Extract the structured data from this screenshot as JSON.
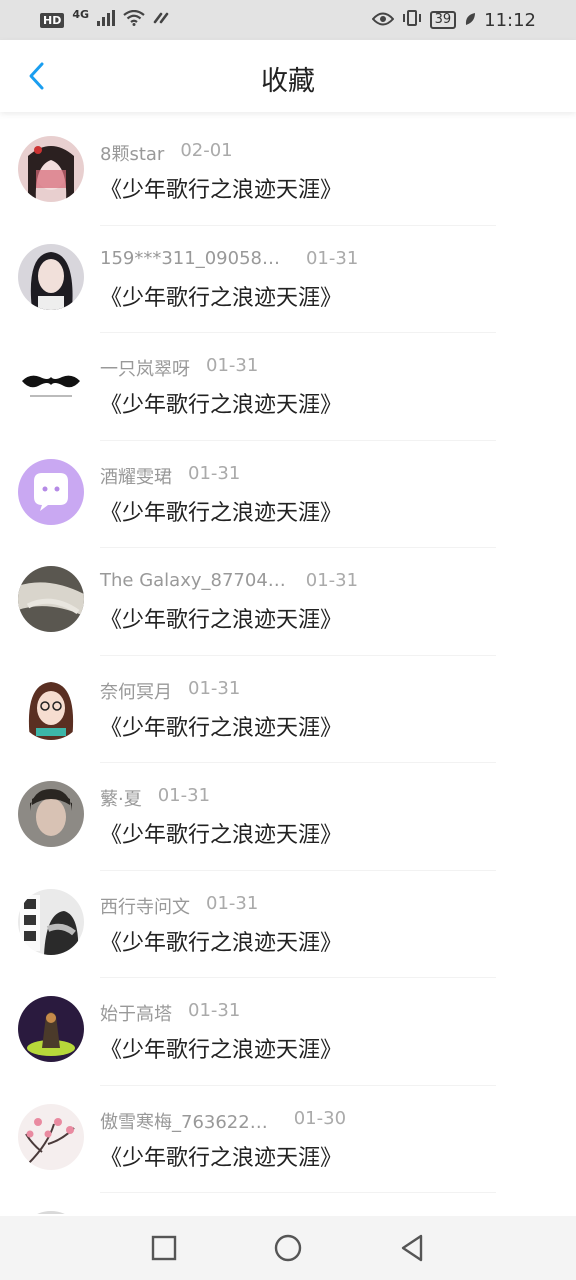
{
  "status": {
    "hd": "HD",
    "network": "4G",
    "battery": "39",
    "time": "11:12"
  },
  "header": {
    "title": "收藏",
    "back_icon": "chevron-left-icon"
  },
  "items": [
    {
      "user": "8颗star",
      "date": "02-01",
      "work": "《少年歌行之浪迹天涯》"
    },
    {
      "user": "159***311_09058…",
      "date": "01-31",
      "work": "《少年歌行之浪迹天涯》"
    },
    {
      "user": "一只岚翠呀",
      "date": "01-31",
      "work": "《少年歌行之浪迹天涯》"
    },
    {
      "user": "酒耀雯珺",
      "date": "01-31",
      "work": "《少年歌行之浪迹天涯》"
    },
    {
      "user": "The Galaxy_87704…",
      "date": "01-31",
      "work": "《少年歌行之浪迹天涯》"
    },
    {
      "user": "奈何冥月",
      "date": "01-31",
      "work": "《少年歌行之浪迹天涯》"
    },
    {
      "user": "蘩·夏",
      "date": "01-31",
      "work": "《少年歌行之浪迹天涯》"
    },
    {
      "user": "西行寺问文",
      "date": "01-31",
      "work": "《少年歌行之浪迹天涯》"
    },
    {
      "user": "始于高塔",
      "date": "01-31",
      "work": "《少年歌行之浪迹天涯》"
    },
    {
      "user": "傲雪寒梅_763622…",
      "date": "01-30",
      "work": "《少年歌行之浪迹天涯》"
    }
  ],
  "colors": {
    "accent": "#1a9ef0",
    "avatar_purple": "#c9a8f2"
  },
  "nav": {
    "recent_icon": "square-icon",
    "home_icon": "circle-icon",
    "back_icon": "triangle-back-icon"
  }
}
